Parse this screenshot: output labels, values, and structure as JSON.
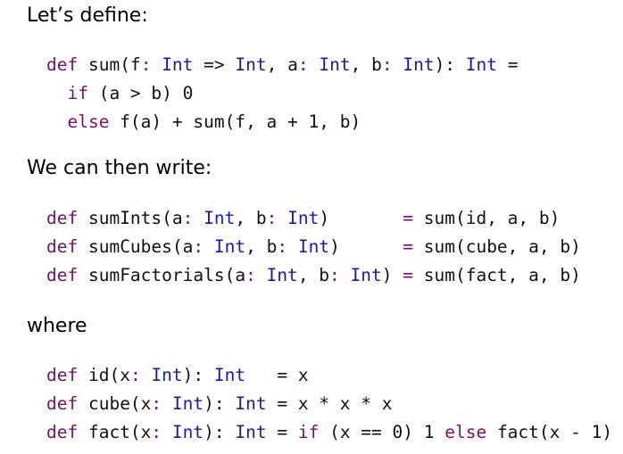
{
  "colors": {
    "keyword": "#7a0f6e",
    "type": "#1a1aa8",
    "operator": "#7a0f6e",
    "text": "#111111"
  },
  "intro_text": "Let’s define:",
  "sum_definition": [
    [
      [
        "kw",
        "def"
      ],
      [
        "pl",
        " sum(f"
      ],
      [
        "op",
        ":"
      ],
      [
        "pl",
        " "
      ],
      [
        "ty",
        "Int"
      ],
      [
        "pl",
        " => "
      ],
      [
        "ty",
        "Int"
      ],
      [
        "pl",
        ", a"
      ],
      [
        "op",
        ":"
      ],
      [
        "pl",
        " "
      ],
      [
        "ty",
        "Int"
      ],
      [
        "pl",
        ", b"
      ],
      [
        "op",
        ":"
      ],
      [
        "pl",
        " "
      ],
      [
        "ty",
        "Int"
      ],
      [
        "pl",
        "): "
      ],
      [
        "ty",
        "Int"
      ],
      [
        "pl",
        " ="
      ]
    ],
    [
      [
        "pl",
        "  "
      ],
      [
        "kw",
        "if"
      ],
      [
        "pl",
        " (a > b) 0"
      ]
    ],
    [
      [
        "pl",
        "  "
      ],
      [
        "kw",
        "else"
      ],
      [
        "pl",
        " f(a) + sum(f, a + 1, b)"
      ]
    ]
  ],
  "then_text": "We can then write:",
  "sum_uses": [
    [
      [
        "kw",
        "def"
      ],
      [
        "pl",
        " sumInts(a"
      ],
      [
        "op",
        ":"
      ],
      [
        "pl",
        " "
      ],
      [
        "ty",
        "Int"
      ],
      [
        "pl",
        ", b"
      ],
      [
        "op",
        ":"
      ],
      [
        "pl",
        " "
      ],
      [
        "ty",
        "Int"
      ],
      [
        "pl",
        ")       "
      ],
      [
        "op",
        "="
      ],
      [
        "pl",
        " sum(id, a, b)"
      ]
    ],
    [
      [
        "kw",
        "def"
      ],
      [
        "pl",
        " sumCubes(a"
      ],
      [
        "op",
        ":"
      ],
      [
        "pl",
        " "
      ],
      [
        "ty",
        "Int"
      ],
      [
        "pl",
        ", b"
      ],
      [
        "op",
        ":"
      ],
      [
        "pl",
        " "
      ],
      [
        "ty",
        "Int"
      ],
      [
        "pl",
        ")      "
      ],
      [
        "op",
        "="
      ],
      [
        "pl",
        " sum(cube, a, b)"
      ]
    ],
    [
      [
        "kw",
        "def"
      ],
      [
        "pl",
        " sumFactorials(a"
      ],
      [
        "op",
        ":"
      ],
      [
        "pl",
        " "
      ],
      [
        "ty",
        "Int"
      ],
      [
        "pl",
        ", b"
      ],
      [
        "op",
        ":"
      ],
      [
        "pl",
        " "
      ],
      [
        "ty",
        "Int"
      ],
      [
        "pl",
        ") "
      ],
      [
        "op",
        "="
      ],
      [
        "pl",
        " sum(fact, a, b)"
      ]
    ]
  ],
  "where_text": "where",
  "helper_definitions": [
    [
      [
        "kw",
        "def"
      ],
      [
        "pl",
        " id(x"
      ],
      [
        "op",
        ":"
      ],
      [
        "pl",
        " "
      ],
      [
        "ty",
        "Int"
      ],
      [
        "pl",
        "): "
      ],
      [
        "ty",
        "Int"
      ],
      [
        "pl",
        "   = x"
      ]
    ],
    [
      [
        "kw",
        "def"
      ],
      [
        "pl",
        " cube(x"
      ],
      [
        "op",
        ":"
      ],
      [
        "pl",
        " "
      ],
      [
        "ty",
        "Int"
      ],
      [
        "pl",
        "): "
      ],
      [
        "ty",
        "Int"
      ],
      [
        "pl",
        " = x * x * x"
      ]
    ],
    [
      [
        "kw",
        "def"
      ],
      [
        "pl",
        " fact(x"
      ],
      [
        "op",
        ":"
      ],
      [
        "pl",
        " "
      ],
      [
        "ty",
        "Int"
      ],
      [
        "pl",
        "): "
      ],
      [
        "ty",
        "Int"
      ],
      [
        "pl",
        " = "
      ],
      [
        "kw",
        "if"
      ],
      [
        "pl",
        " (x == 0) 1 "
      ],
      [
        "kw",
        "else"
      ],
      [
        "pl",
        " fact(x - 1)"
      ]
    ]
  ]
}
